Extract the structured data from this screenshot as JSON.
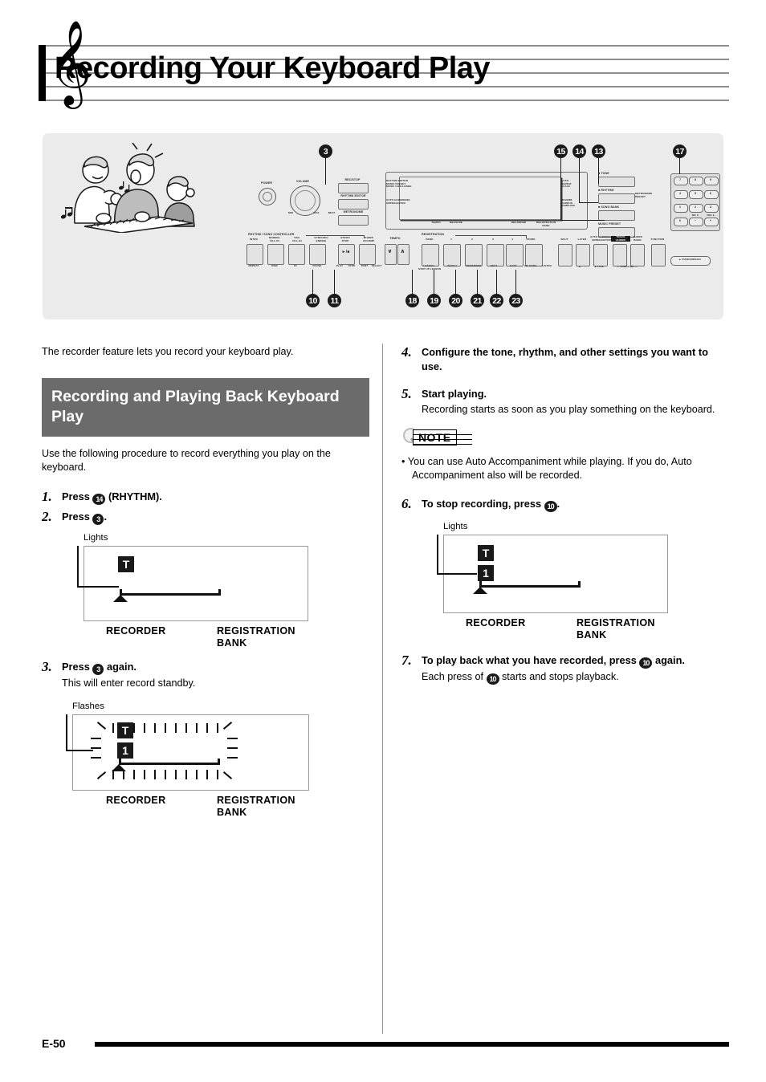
{
  "page": {
    "title": "Recording Your Keyboard Play",
    "footer_number": "E-50",
    "clef_icon": "treble-clef-icon"
  },
  "intro": "The recorder feature lets you record your keyboard play.",
  "section": {
    "heading": "Recording and Playing Back Keyboard Play",
    "lead_in": "Use the following procedure to record everything you play on the keyboard.",
    "heading_bg": "#6b6b6b"
  },
  "diagram": {
    "illustration_name": "people-playing-keyboard-illustration",
    "callouts": [
      "3",
      "10",
      "11",
      "13",
      "14",
      "15",
      "17",
      "18",
      "19",
      "20",
      "21",
      "22",
      "23"
    ],
    "controls": {
      "power": "POWER",
      "volume": "VOLUME",
      "volume_min": "MIN",
      "volume_max": "MAX",
      "rec_stop": "REC/STOP",
      "rhythm_editor": "RHYTHM EDITOR",
      "metronome": "METRONOME",
      "beat": "BEAT",
      "controller_group": "RHYTHM / SONG CONTROLLER",
      "tempo": "TEMPO",
      "tempo_down": "∨",
      "tempo_up": "∧"
    },
    "controller_top": [
      "INTRO",
      "NORMAL/FILL-IN",
      "VAR./FILL-IN",
      "SYNCHRO/ENDING",
      "START/STOP",
      "CHORD/ACCOMP"
    ],
    "controller_bottom": [
      "REPEAT",
      "REW",
      "FF",
      "PAUSE",
      "PLAY/STOP",
      "PART SELECT"
    ],
    "display_labels_left": [
      "RHYTHM EDITOR",
      "MUSIC PRESET",
      "MUSIC CHALLENGE",
      "AUTO HARMONIZE",
      "ARPEGGIATOR"
    ],
    "display_labels_right": [
      "AUTO",
      "REPEAT",
      "SCALE",
      "REVERB",
      "CHORUS",
      "SAMPLING"
    ],
    "display_labels_bottom": [
      "TEMPO",
      "MEASURE",
      "RECORDER",
      "REGISTRATION BANK"
    ],
    "mode_buttons": [
      "TONE",
      "RHYTHM",
      "SONG BANK",
      "MUSIC PRESET"
    ],
    "mode_side_labels": [
      "METRONOME PRESET"
    ],
    "registration": {
      "group": "REGISTRATION",
      "bank": "BANK",
      "numbers": [
        "1",
        "2",
        "3",
        "4"
      ],
      "store": "STORE",
      "lesson_labels": [
        "LESSON",
        "STEP UP LESSON",
        "WATCH",
        "REMEMBER",
        "NEXT",
        "AUTO",
        "MY SONG",
        "LISTEN"
      ]
    },
    "function_buttons": [
      "SPLIT",
      "LAYER",
      "AUTO HARMONIZE/ARPEGGIATOR",
      "TRACK CHORD",
      "CHORD BOOK",
      "FUNCTION"
    ],
    "function_sub_labels": [
      "TYPE",
      "SAMPLING",
      "PIANO/ORGAN"
    ],
    "keypad": [
      "7",
      "8",
      "9",
      "4",
      "5",
      "6",
      "1",
      "2",
      "3",
      "0",
      "-",
      "+"
    ],
    "keypad_sub": [
      "YES",
      "NO"
    ]
  },
  "steps_left": [
    {
      "num": "1.",
      "title_parts": [
        "Press ",
        "14",
        " (RHYTHM)."
      ],
      "button": "14",
      "pre": "Press ",
      "post": " (RHYTHM)."
    },
    {
      "num": "2.",
      "pre": "Press ",
      "button": "3",
      "post": ".",
      "figure": {
        "callout": "Lights",
        "badges": [
          "T"
        ],
        "label_recorder": "RECORDER",
        "label_registration": "REGISTRATION BANK"
      }
    },
    {
      "num": "3.",
      "pre": "Press ",
      "button": "3",
      "post": " again.",
      "body": "This will enter record standby.",
      "figure": {
        "callout": "Flashes",
        "badges": [
          "T",
          "1"
        ],
        "label_recorder": "RECORDER",
        "label_registration": "REGISTRATION BANK"
      }
    }
  ],
  "steps_right": [
    {
      "num": "4.",
      "title": "Configure the tone, rhythm, and other settings you want to use."
    },
    {
      "num": "5.",
      "title": "Start playing.",
      "body": "Recording starts as soon as you play something on the keyboard."
    },
    {
      "num": "6.",
      "pre": "To stop recording, press ",
      "button": "10",
      "post": ".",
      "figure": {
        "callout": "Lights",
        "badges": [
          "T",
          "1"
        ],
        "label_recorder": "RECORDER",
        "label_registration": "REGISTRATION BANK"
      }
    },
    {
      "num": "7.",
      "pre": "To play back what you have recorded, press ",
      "button": "10",
      "post": " again.",
      "body_pre": "Each press of ",
      "body_button": "10",
      "body_post": " starts and stops playback."
    }
  ],
  "note": {
    "label": "NOTE",
    "icon": "magnifier-icon",
    "items": [
      "You can use Auto Accompaniment while playing. If you do, Auto Accompaniment also will be recorded."
    ]
  }
}
